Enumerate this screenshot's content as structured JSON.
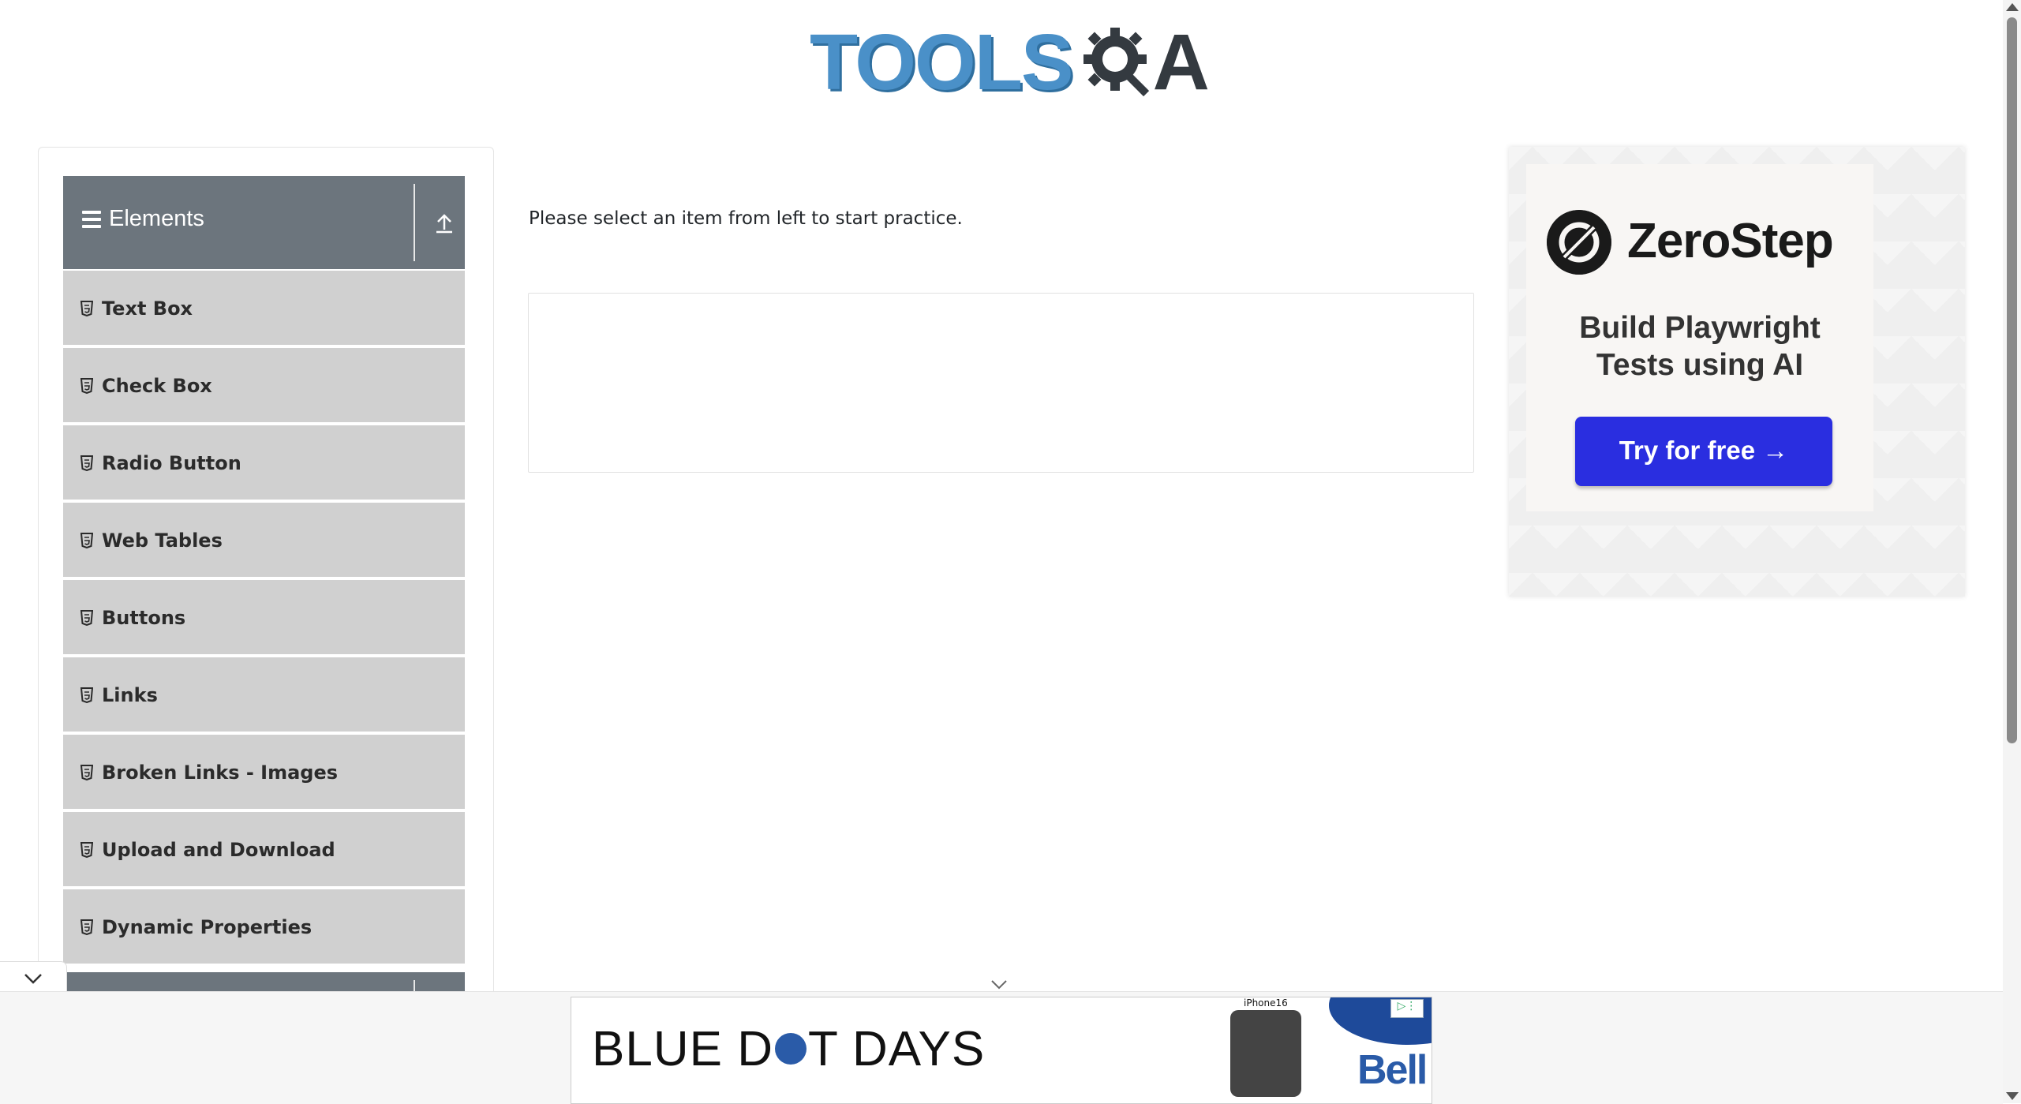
{
  "logo": {
    "part1": "TOOLS",
    "part2": "A",
    "gear_icon": "gear-magnifier-icon"
  },
  "sidebar": {
    "group_title": "Elements",
    "items": [
      {
        "label": "Text Box",
        "icon": "html5-icon"
      },
      {
        "label": "Check Box",
        "icon": "html5-icon"
      },
      {
        "label": "Radio Button",
        "icon": "html5-icon"
      },
      {
        "label": "Web Tables",
        "icon": "html5-icon"
      },
      {
        "label": "Buttons",
        "icon": "html5-icon"
      },
      {
        "label": "Links",
        "icon": "html5-icon"
      },
      {
        "label": "Broken Links - Images",
        "icon": "html5-icon"
      },
      {
        "label": "Upload and Download",
        "icon": "html5-icon"
      },
      {
        "label": "Dynamic Properties",
        "icon": "html5-icon"
      }
    ]
  },
  "main": {
    "prompt": "Please select an item from left to start practice."
  },
  "ad_right": {
    "brand": "ZeroStep",
    "tagline_line1": "Build Playwright",
    "tagline_line2": "Tests using AI",
    "cta": "Try for free →",
    "cta_color": "#2a2ee0"
  },
  "ad_bottom": {
    "headline_part1": "BLUE D",
    "headline_part2": "T DAYS",
    "product": "iPhone16",
    "brand": "Bell",
    "brand_color": "#2a5ba8"
  },
  "colors": {
    "sidebar_header": "#6c757d",
    "menu_item": "#d0d0d0",
    "logo_blue": "#4a90c8"
  }
}
